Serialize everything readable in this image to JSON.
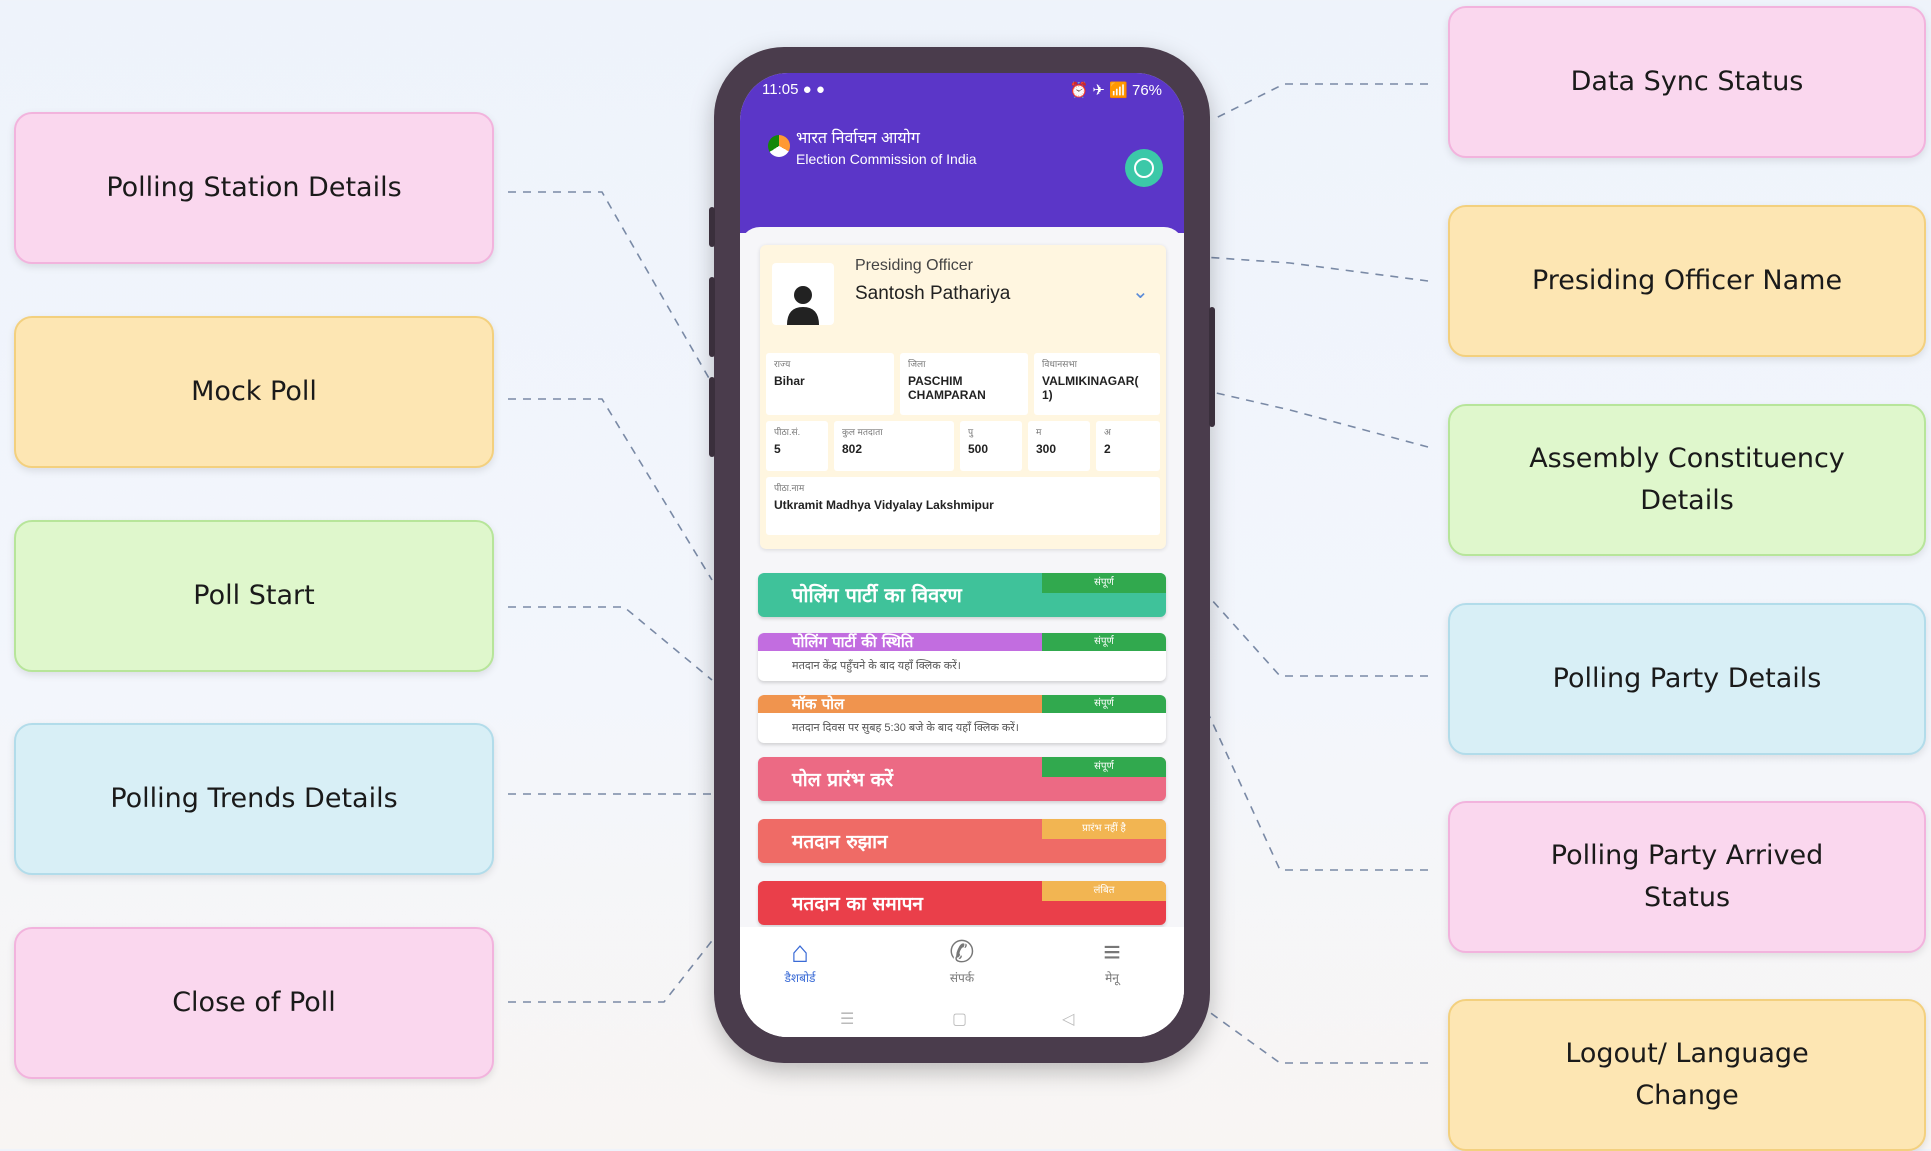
{
  "callouts": {
    "polling_station_details": "Polling Station Details",
    "mock_poll": "Mock Poll",
    "poll_start": "Poll Start",
    "polling_trends_details": "Polling Trends Details",
    "close_of_poll": "Close of Poll",
    "data_sync_status": "Data Sync Status",
    "presiding_officer_name": "Presiding Officer Name",
    "assembly_constituency_line1": "Assembly Constituency",
    "assembly_constituency_line2": "Details",
    "polling_party_details": "Polling Party Details",
    "polling_party_arrived_line1": "Polling Party Arrived",
    "polling_party_arrived_line2": "Status",
    "logout_language_line1": "Logout/ Language",
    "logout_language_line2": "Change"
  },
  "colors": {
    "pink": "#fad7ee",
    "yellow": "#fde6b3",
    "green": "#dff7cc",
    "blue": "#d8eff6",
    "app_purple": "#5b36c8",
    "teal": "#3cc8a8"
  },
  "phone": {
    "status": {
      "time": "11:05",
      "left_icons": "● ●",
      "right_icons": "⏰ ✈ 📶 76%"
    },
    "header": {
      "title_hi": "भारत निर्वाचन आयोग",
      "title_en": "Election Commission of India",
      "sync_icon": "sync-status-icon"
    },
    "officer": {
      "label": "Presiding Officer",
      "name": "Santosh Pathariya"
    },
    "details": {
      "state_label": "राज्य",
      "state_value": "Bihar",
      "district_label": "जिला",
      "district_value": "PASCHIM CHAMPARAN",
      "ac_label": "विधानसभा",
      "ac_value": "VALMIKINAGAR( 1)",
      "booth_no_label": "पीठा.सं.",
      "booth_no_value": "5",
      "total_voters_label": "कुल मतदाता",
      "total_voters_value": "802",
      "male_label": "पु",
      "male_value": "500",
      "female_label": "म",
      "female_value": "300",
      "other_label": "अ",
      "other_value": "2",
      "booth_name_label": "पीठा.नाम",
      "booth_name_value": "Utkramit Madhya Vidyalay Lakshmipur"
    },
    "rows": [
      {
        "title": "पोलिंग पार्टी का विवरण",
        "badge": "संपूर्ण",
        "sub": ""
      },
      {
        "title": "पोलिंग पार्टी की स्थिति",
        "badge": "संपूर्ण",
        "sub": "मतदान केंद्र पहुँचने के बाद यहाँ क्लिक करें।"
      },
      {
        "title": "मॉक पोल",
        "badge": "संपूर्ण",
        "sub": "मतदान दिवस पर सुबह 5:30 बजे के बाद यहाँ क्लिक करें।"
      },
      {
        "title": "पोल प्रारंभ करें",
        "badge": "संपूर्ण",
        "sub": ""
      },
      {
        "title": "मतदान रुझान",
        "badge": "प्रारंभ नहीं है",
        "sub": ""
      },
      {
        "title": "मतदान का समापन",
        "badge": "लंबित",
        "sub": ""
      }
    ],
    "nav": {
      "dashboard": "डैशबोर्ड",
      "contact": "संपर्क",
      "menu": "मेनू"
    },
    "sysbar": {
      "recent": "☰",
      "home": "▢",
      "back": "◁"
    }
  }
}
